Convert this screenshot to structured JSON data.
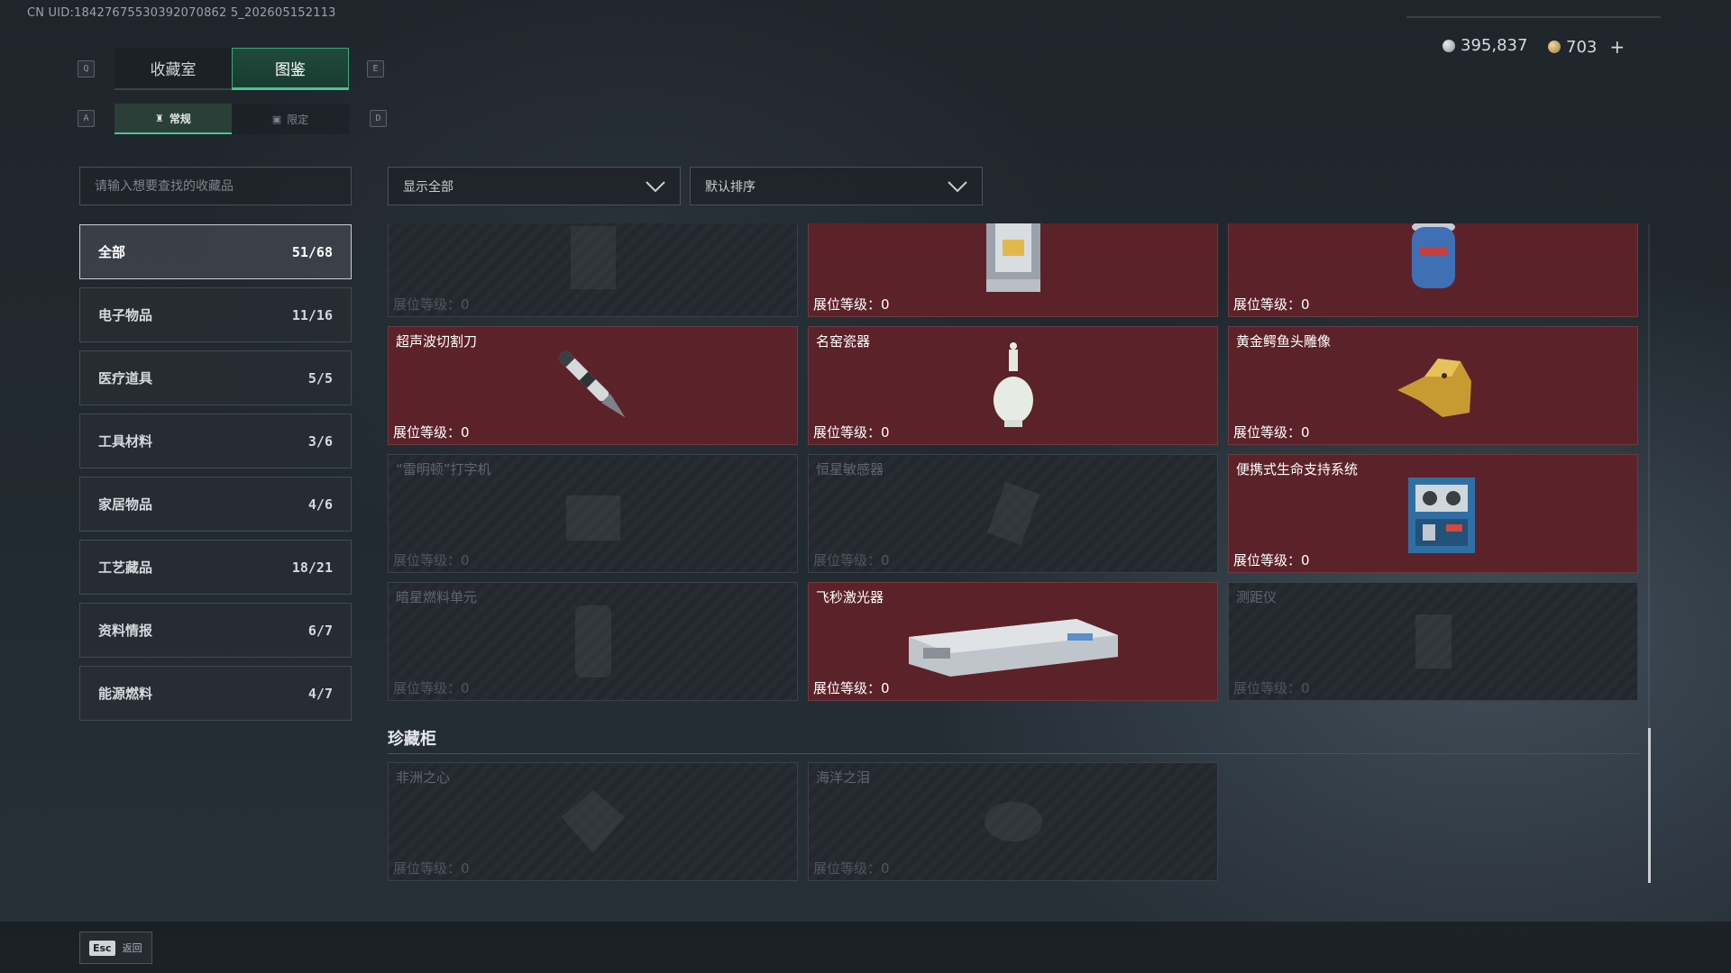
{
  "uid_text": "CN UID:18427675530392070862 5_202605152113",
  "currency": {
    "silver": "395,837",
    "gold": "703",
    "add_label": "+"
  },
  "keys": {
    "prev_tab": "Q",
    "next_tab": "E",
    "prev_sub": "A",
    "next_sub": "D"
  },
  "tabs": [
    {
      "label": "收藏室"
    },
    {
      "label": "图鉴"
    }
  ],
  "subtabs": [
    {
      "label": "常规"
    },
    {
      "label": "限定"
    }
  ],
  "search": {
    "placeholder": "请输入想要查找的收藏品"
  },
  "filters": {
    "show": "显示全部",
    "sort": "默认排序"
  },
  "categories": [
    {
      "label": "全部",
      "count": "51/68"
    },
    {
      "label": "电子物品",
      "count": "11/16"
    },
    {
      "label": "医疗道具",
      "count": "5/5"
    },
    {
      "label": "工具材料",
      "count": "3/6"
    },
    {
      "label": "家居物品",
      "count": "4/6"
    },
    {
      "label": "工艺藏品",
      "count": "18/21"
    },
    {
      "label": "资料情报",
      "count": "6/7"
    },
    {
      "label": "能源燃料",
      "count": "4/7"
    }
  ],
  "level_label": "展位等级：0",
  "items": [
    {
      "name": "",
      "owned": false
    },
    {
      "name": "",
      "owned": true
    },
    {
      "name": "",
      "owned": true
    },
    {
      "name": "超声波切割刀",
      "owned": true
    },
    {
      "name": "名窑瓷器",
      "owned": true
    },
    {
      "name": "黄金鳄鱼头雕像",
      "owned": true
    },
    {
      "name": "“雷明顿”打字机",
      "owned": false
    },
    {
      "name": "恒星敏感器",
      "owned": false
    },
    {
      "name": "便携式生命支持系统",
      "owned": true
    },
    {
      "name": "暗星燃料单元",
      "owned": false
    },
    {
      "name": "飞秒激光器",
      "owned": true
    },
    {
      "name": "测距仪",
      "owned": false
    }
  ],
  "cabinet": {
    "title": "珍藏柜",
    "items": [
      {
        "name": "非洲之心",
        "owned": false
      },
      {
        "name": "海洋之泪",
        "owned": false
      }
    ]
  },
  "footer": {
    "esc_key": "Esc",
    "back_label": "返回"
  },
  "colors": {
    "accent": "#48c58f",
    "owned_bg": "#5c2229"
  }
}
